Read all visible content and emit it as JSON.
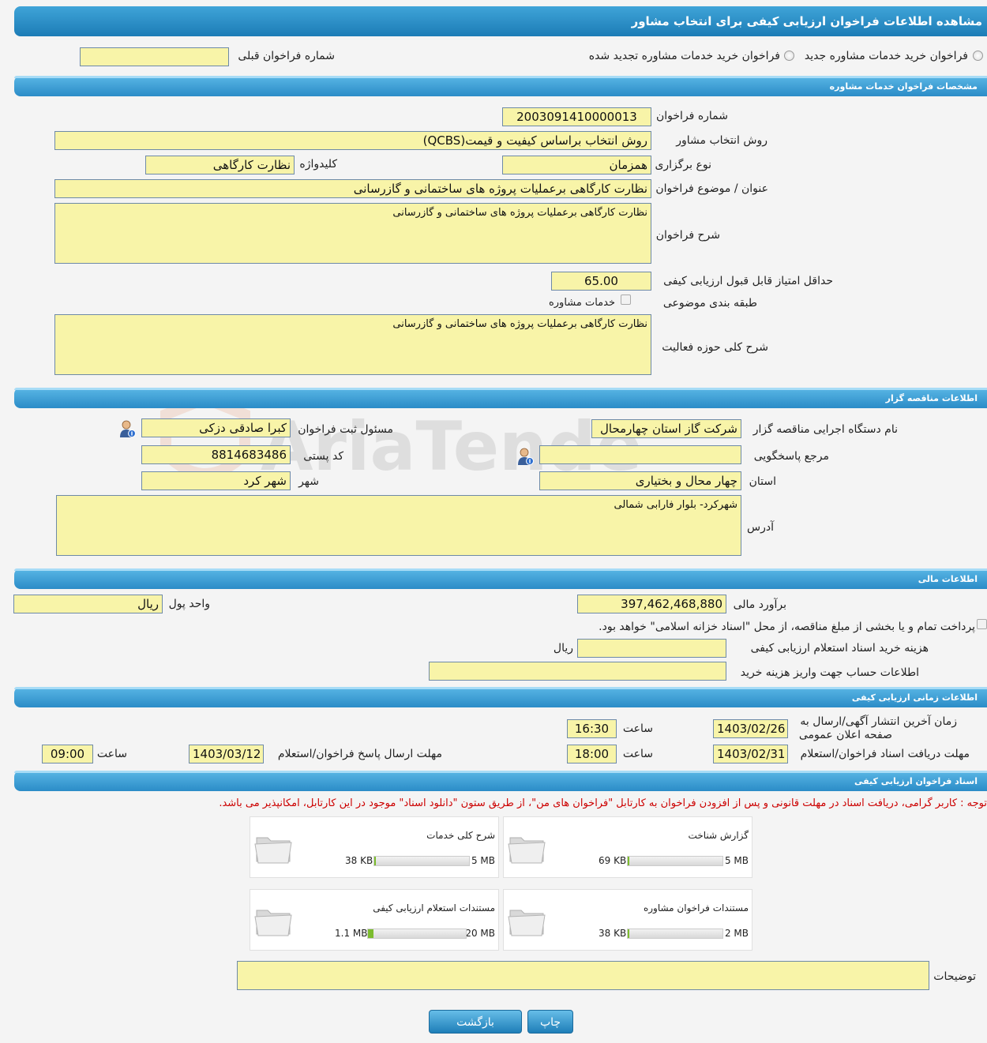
{
  "page": {
    "title": "مشاهده اطلاعات فراخوان ارزیابی کیفی برای انتخاب مشاور"
  },
  "top": {
    "radio_new": "فراخوان خرید خدمات مشاوره جدید",
    "radio_renewed": "فراخوان خرید خدمات مشاوره تجدید شده",
    "prev_number_label": "شماره فراخوان قبلی",
    "prev_number_value": ""
  },
  "sections": {
    "consult": "مشخصات فراخوان خدمات مشاوره",
    "tenderer": "اطلاعات مناقصه گزار",
    "financial": "اطلاعات مالی",
    "timing": "اطلاعات زمانی ارزیابی کیفی",
    "documents": "اسناد فراخوان ارزیابی کیفی"
  },
  "consult": {
    "number_label": "شماره فراخوان",
    "number_value": "2003091410000013",
    "method_label": "روش انتخاب مشاور",
    "method_value": "روش انتخاب براساس کیفیت و قیمت(QCBS)",
    "holding_label": "نوع برگزاری",
    "holding_value": "همزمان",
    "keyword_label": "کلیدواژه",
    "keyword_value": "نظارت کارگاهی",
    "subject_label": "عنوان / موضوع فراخوان",
    "subject_value": "نظارت کارگاهی برعملیات پروژه های ساختمانی و گازرسانی",
    "desc_label": "شرح فراخوان",
    "desc_value": "نظارت کارگاهی برعملیات پروژه های ساختمانی و گازرسانی",
    "min_score_label": "حداقل امتیاز قابل قبول ارزیابی کیفی",
    "min_score_value": "65.00",
    "category_label": "طبقه بندی موضوعی",
    "category_value": "خدمات مشاوره",
    "activity_label": "شرح کلی حوزه فعالیت",
    "activity_value": "نظارت کارگاهی برعملیات پروژه های ساختمانی و گازرسانی"
  },
  "tenderer": {
    "org_label": "نام دستگاه اجرایی مناقصه گزار",
    "org_value": "شرکت گاز استان چهارمحال",
    "registrar_label": "مسئول ثبت فراخوان",
    "registrar_value": "کبرا صادقی دزکی",
    "ref_label": "مرجع پاسخگویی",
    "ref_value": "",
    "postal_label": "کد پستی",
    "postal_value": "8814683486",
    "province_label": "استان",
    "province_value": "چهار محال و بختیاری",
    "city_label": "شهر",
    "city_value": "شهر کرد",
    "address_label": "آدرس",
    "address_value": "شهرکرد- بلوار فارابی شمالی"
  },
  "financial": {
    "estimate_label": "برآورد مالی",
    "estimate_value": "397,462,468,880",
    "currency_label": "واحد پول",
    "currency_value": "ریال",
    "treasury_text": "پرداخت تمام و یا بخشی از مبلغ مناقصه، از محل \"اسناد خزانه اسلامی\" خواهد بود.",
    "doc_cost_label": "هزینه خرید اسناد استعلام ارزیابی کیفی",
    "doc_cost_value": "",
    "doc_cost_unit": "ریال",
    "account_label": "اطلاعات حساب جهت واریز هزینه خرید",
    "account_value": ""
  },
  "timing": {
    "publish_label_1": "زمان آخرین انتشار آگهی/ارسال به",
    "publish_label_2": "صفحه اعلان عمومی",
    "publish_date": "1403/02/26",
    "publish_time_label": "ساعت",
    "publish_time": "16:30",
    "receive_label": "مهلت دریافت اسناد فراخوان/استعلام",
    "receive_date": "1403/02/31",
    "receive_time_label": "ساعت",
    "receive_time": "18:00",
    "submit_label": "مهلت ارسال پاسخ فراخوان/استعلام",
    "submit_date": "1403/03/12",
    "submit_time_label": "ساعت",
    "submit_time": "09:00"
  },
  "documents": {
    "note": "توجه : کاربر گرامی، دریافت اسناد در مهلت قانونی و پس از افزودن فراخوان به کارتابل \"فراخوان های من\"، از طریق ستون \"دانلود اسناد\" موجود در این کارتابل، امکانپذیر می باشد.",
    "files": [
      {
        "name": "گزارش شناخت",
        "max": "5 MB",
        "size": "69 KB",
        "fill": 0.014
      },
      {
        "name": "شرح کلی خدمات",
        "max": "5 MB",
        "size": "38 KB",
        "fill": 0.008
      },
      {
        "name": "مستندات فراخوان مشاوره",
        "max": "2 MB",
        "size": "38 KB",
        "fill": 0.019
      },
      {
        "name": "مستندات استعلام ارزیابی کیفی",
        "max": "20 MB",
        "size": "1.1 MB",
        "fill": 0.055
      }
    ],
    "comments_label": "توضیحات",
    "comments_value": ""
  },
  "buttons": {
    "print": "چاپ",
    "back": "بازگشت"
  },
  "colors": {
    "header_blue": "#1c7cb6",
    "field_yellow": "#f8f4a8",
    "note_red": "#cc0000",
    "progress_green": "#7cbc2e"
  }
}
